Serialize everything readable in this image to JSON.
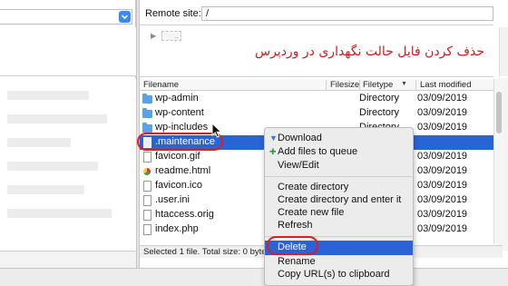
{
  "remote": {
    "label": "Remote site:",
    "path": "/"
  },
  "annotation": "حذف کردن فایل حالت نگهداری در وردپرس",
  "tree_item": "..",
  "columns": {
    "filename": "Filename",
    "filesize": "Filesize",
    "filetype": "Filetype",
    "last_modified": "Last modified"
  },
  "files": [
    {
      "name": "wp-admin",
      "icon": "folder-icon",
      "type": "Directory",
      "modified": "03/09/2019"
    },
    {
      "name": "wp-content",
      "icon": "folder-icon",
      "type": "Directory",
      "modified": "03/09/2019"
    },
    {
      "name": "wp-includes",
      "icon": "folder-icon",
      "type": "Directory",
      "modified": "03/09/2019"
    },
    {
      "name": ".maintenance",
      "icon": "file-icon",
      "type": "",
      "modified": "",
      "selected": true
    },
    {
      "name": "favicon.gif",
      "icon": "file-icon",
      "type": "",
      "modified": "03/09/2019"
    },
    {
      "name": "readme.html",
      "icon": "html-file-icon",
      "type": "",
      "modified": "03/09/2019"
    },
    {
      "name": "favicon.ico",
      "icon": "file-icon",
      "type": "",
      "modified": "03/09/2019"
    },
    {
      "name": ".user.ini",
      "icon": "file-icon",
      "type": "",
      "modified": "03/09/2019"
    },
    {
      "name": "htaccess.orig",
      "icon": "file-icon",
      "type": "",
      "modified": "03/09/2019"
    },
    {
      "name": "index.php",
      "icon": "file-icon",
      "type": "",
      "modified": "03/09/2019"
    }
  ],
  "status": "Selected 1 file. Total size: 0 byte",
  "context_menu": {
    "download": "Download",
    "add_to_queue": "Add files to queue",
    "view_edit": "View/Edit",
    "create_directory": "Create directory",
    "create_directory_enter": "Create directory and enter it",
    "create_new_file": "Create new file",
    "refresh": "Refresh",
    "delete": "Delete",
    "rename": "Rename",
    "copy_url": "Copy URL(s) to clipboard"
  },
  "colors": {
    "selection": "#2a63d6",
    "annotation_red": "#e01c1c",
    "folder_blue": "#5aa0ec",
    "download_arrow": "#2f7ae5",
    "add_arrow": "#2e9e3e"
  }
}
